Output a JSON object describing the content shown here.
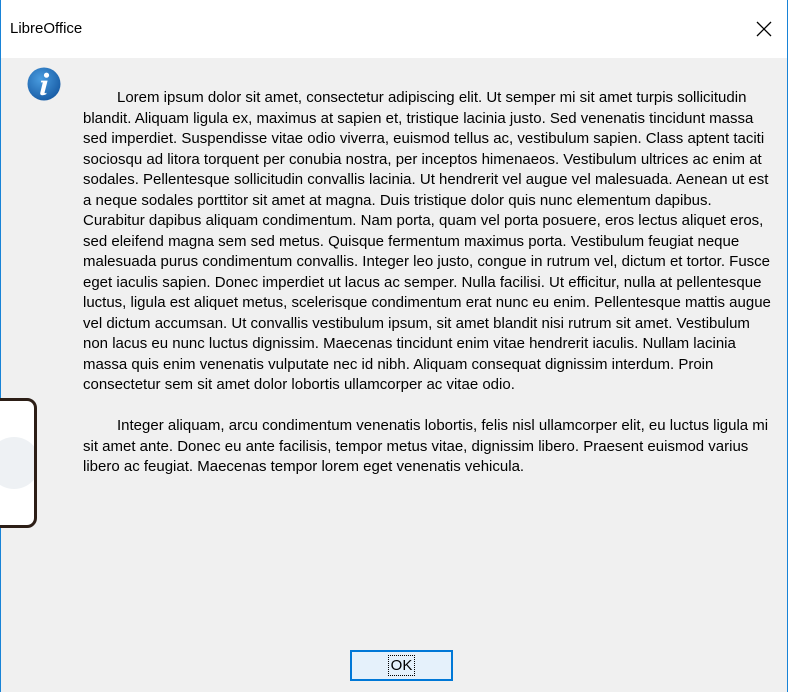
{
  "window": {
    "title": "LibreOffice",
    "close_icon": "close-icon",
    "accent_color": "#1883d7"
  },
  "dialog": {
    "icon": "info-icon",
    "icon_color": "#1e73be",
    "paragraphs": [
      "Lorem ipsum dolor sit amet, consectetur adipiscing elit. Ut semper mi sit amet turpis sollicitudin blandit. Aliquam ligula ex, maximus at sapien et, tristique lacinia justo. Sed venenatis tincidunt massa sed imperdiet. Suspendisse vitae odio viverra, euismod tellus ac, vestibulum sapien. Class aptent taciti sociosqu ad litora torquent per conubia nostra, per inceptos himenaeos. Vestibulum ultrices ac enim at sodales. Pellentesque sollicitudin convallis lacinia. Ut hendrerit vel augue vel malesuada. Aenean ut est a neque sodales porttitor sit amet at magna. Duis tristique dolor quis nunc elementum dapibus. Curabitur dapibus aliquam condimentum. Nam porta, quam vel porta posuere, eros lectus aliquet eros, sed eleifend magna sem sed metus. Quisque fermentum maximus porta. Vestibulum feugiat neque malesuada purus condimentum convallis. Integer leo justo, congue in rutrum vel, dictum et tortor. Fusce eget iaculis sapien. Donec imperdiet ut lacus ac semper. Nulla facilisi. Ut efficitur, nulla at pellentesque luctus, ligula est aliquet metus, scelerisque condimentum erat nunc eu enim. Pellentesque mattis augue vel dictum accumsan. Ut convallis vestibulum ipsum, sit amet blandit nisi rutrum sit amet. Vestibulum non lacus eu nunc luctus dignissim. Maecenas tincidunt enim vitae hendrerit iaculis. Nullam lacinia massa quis enim venenatis vulputate nec id nibh. Aliquam consequat dignissim interdum. Proin consectetur sem sit amet dolor lobortis ullamcorper ac vitae odio.",
      "Integer aliquam, arcu condimentum venenatis lobortis, felis nisl ullamcorper elit, eu luctus ligula mi sit amet ante. Donec eu ante facilisis, tempor metus vitae, dignissim libero. Praesent euismod varius libero ac feugiat. Maecenas tempor lorem eget venenatis vehicula."
    ],
    "ok_label": "OK"
  }
}
